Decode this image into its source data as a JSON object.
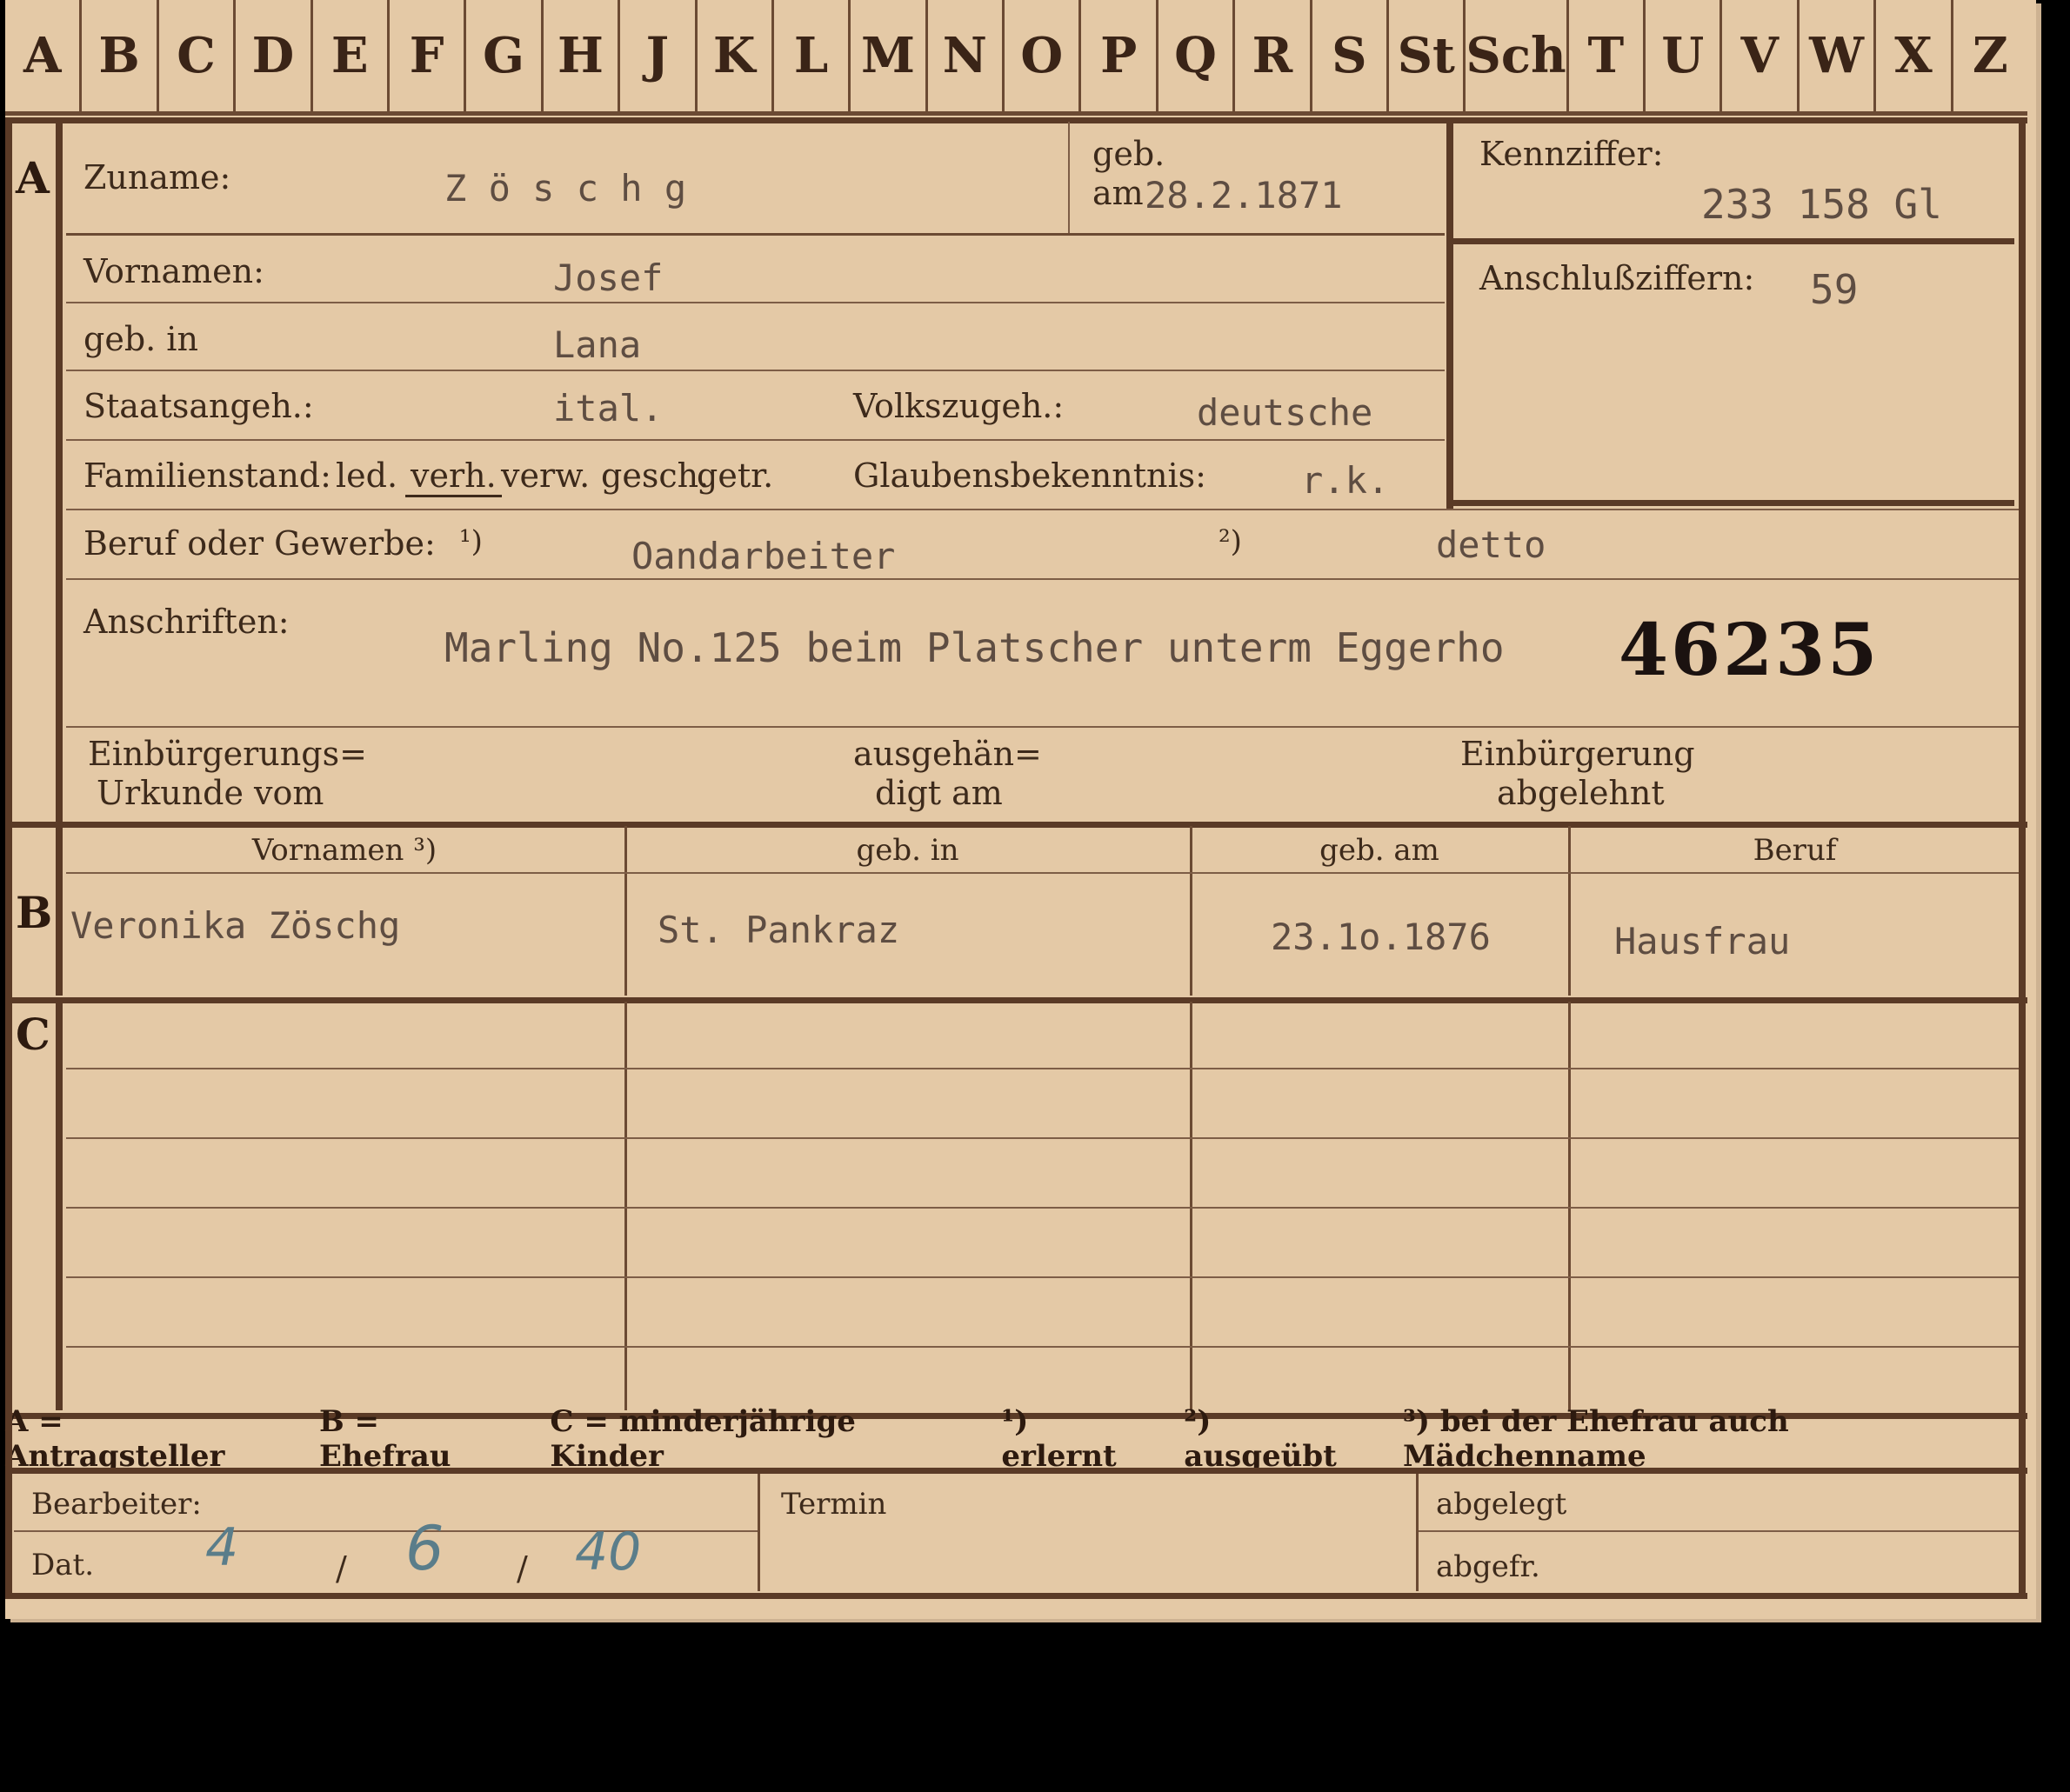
{
  "alphabet_tabs": [
    "A",
    "B",
    "C",
    "D",
    "E",
    "F",
    "G",
    "H",
    "J",
    "K",
    "L",
    "M",
    "N",
    "O",
    "P",
    "Q",
    "R",
    "S",
    "St",
    "Sch",
    "T",
    "U",
    "V",
    "W",
    "X",
    "Z"
  ],
  "section_letters": {
    "a": "A",
    "b": "B",
    "c": "C"
  },
  "applicant": {
    "surname_label": "Zuname:",
    "surname": "Z ö s c h g",
    "born_label_1": "geb.",
    "born_label_2": "am",
    "born_date": "28.2.1871",
    "first_names_label": "Vornamen:",
    "first_names": "Josef",
    "birthplace_label": "geb. in",
    "birthplace": "Lana",
    "citizenship_label": "Staatsangeh.:",
    "citizenship": "ital.",
    "ethnicity_label": "Volkszugeh.:",
    "ethnicity": "deutsche",
    "marital_label": "Familienstand:",
    "marital_options": [
      "led.",
      "verh.",
      "verw.",
      "gesch.",
      "getr."
    ],
    "marital_selected": "verh.",
    "religion_label": "Glaubensbekenntnis:",
    "religion": "r.k.",
    "occupation_label": "Beruf oder Gewerbe:",
    "occupation_note1": "¹)",
    "occupation_learned": "Oandarbeiter",
    "occupation_note2": "²)",
    "occupation_practiced": "detto",
    "address_label": "Anschriften:",
    "address": "Marling No.125 beim Platscher unterm Eggerho",
    "stamp_number": "46235",
    "naturalization_label_1": "Einbürgerungs=",
    "naturalization_label_2": "Urkunde vom",
    "handed_label_1": "ausgehän=",
    "handed_label_2": "digt am",
    "refused_label_1": "Einbürgerung",
    "refused_label_2": "abgelehnt"
  },
  "id_box": {
    "code_label": "Kennziffer:",
    "code": "233 158  Gl",
    "connection_label": "Anschlußziffern:",
    "connection": "59"
  },
  "spouse_table": {
    "headers": [
      "Vornamen ³)",
      "geb. in",
      "geb. am",
      "Beruf"
    ],
    "row": [
      "Veronika Zöschg",
      "St. Pankraz",
      "23.1o.1876",
      "Hausfrau"
    ]
  },
  "legend": {
    "a": "A = Antragsteller",
    "b": "B = Ehefrau",
    "c": "C = minderjährige Kinder",
    "n1": "¹) erlernt",
    "n2": "²) ausgeübt",
    "n3": "³) bei der Ehefrau auch Mädchenname"
  },
  "footer": {
    "clerk_label": "Bearbeiter:",
    "date_label": "Dat.",
    "date_day": "4",
    "date_month": "6",
    "date_year": "40",
    "date_sep": "/",
    "deadline_label": "Termin",
    "filed_label": "abgelegt",
    "retrieved_label": "abgefr."
  },
  "colors": {
    "paper": "#e4c9a6",
    "ink": "#3d2a1b",
    "lines": "#6b4a33",
    "handwriting": "#5a7d8a"
  }
}
